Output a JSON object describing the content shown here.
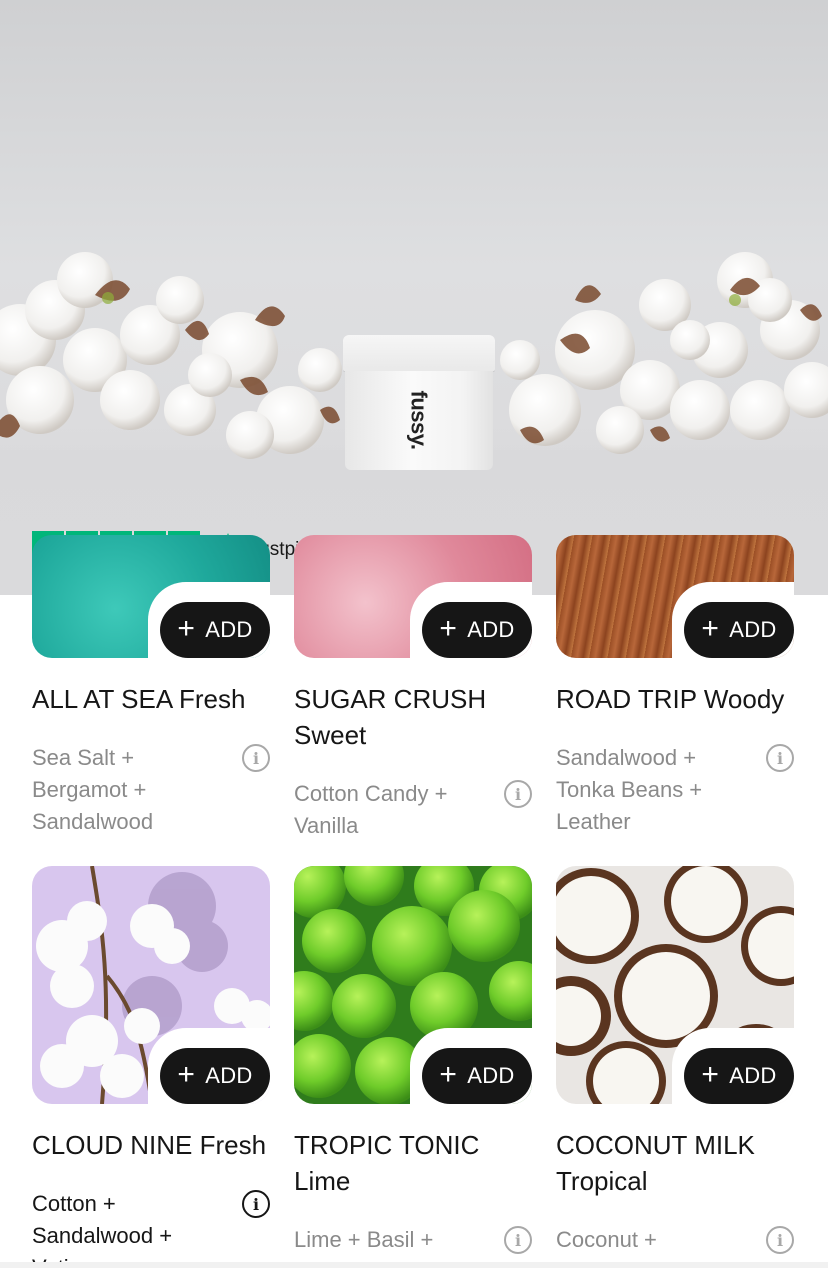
{
  "hero": {
    "brand_logo": "fussy.",
    "rating_stars": 5,
    "rating_label": "Trustpilot",
    "colors": {
      "trustpilot_green": "#00b67a"
    }
  },
  "add_button_label": "ADD",
  "products": [
    {
      "name": "ALL AT SEA Fresh",
      "notes": "Sea Salt + Bergamot + Sandalwood",
      "image": "teal-sea-swirl"
    },
    {
      "name": "SUGAR CRUSH Sweet",
      "notes": "Cotton Candy + Vanilla",
      "image": "pink-cotton-candy"
    },
    {
      "name": "ROAD TRIP Woody",
      "notes": "Sandalwood + Tonka Beans + Leather",
      "image": "brown-wood-texture"
    },
    {
      "name": "CLOUD NINE Fresh",
      "notes": "Cotton + Sandalwood + Vetiver",
      "image": "cotton-on-lilac"
    },
    {
      "name": "TROPIC TONIC Lime",
      "notes": "Lime + Basil +",
      "image": "green-limes"
    },
    {
      "name": "COCONUT MILK Tropical",
      "notes": "Coconut +",
      "image": "split-coconuts"
    }
  ]
}
